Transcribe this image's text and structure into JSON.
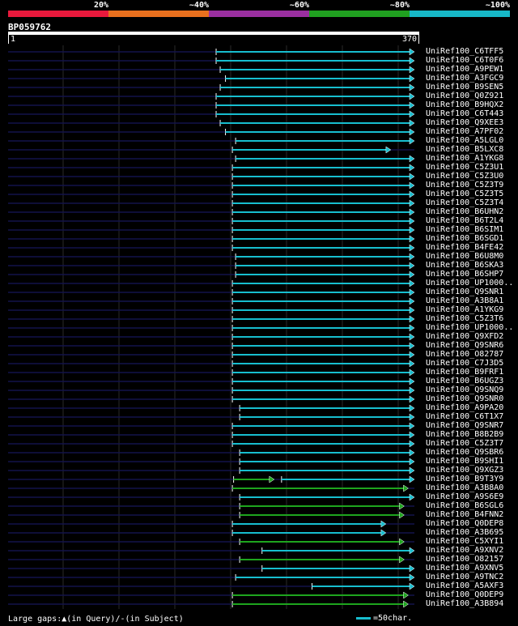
{
  "legend": {
    "labels": [
      "20%",
      "~40%",
      "~60%",
      "~80%",
      "~100%"
    ],
    "colors": [
      "#e8193c",
      "#e8701e",
      "#9a2fa0",
      "#20a020",
      "#17b8c8"
    ]
  },
  "query": {
    "name": "BP059762",
    "start": "1",
    "end": "370"
  },
  "hits": [
    {
      "name": "UniRef100_C6TFF5",
      "segments": [
        {
          "s": 0.512,
          "e": 1.0,
          "c": "cyan",
          "arrow": true
        }
      ]
    },
    {
      "name": "UniRef100_C6T0F6",
      "segments": [
        {
          "s": 0.512,
          "e": 1.0,
          "c": "cyan",
          "arrow": true
        }
      ]
    },
    {
      "name": "UniRef100_A9PEW1",
      "segments": [
        {
          "s": 0.522,
          "e": 1.0,
          "c": "cyan",
          "arrow": true
        }
      ]
    },
    {
      "name": "UniRef100_A3FGC9",
      "segments": [
        {
          "s": 0.535,
          "e": 1.0,
          "c": "cyan",
          "arrow": true
        }
      ]
    },
    {
      "name": "UniRef100_B9SEN5",
      "segments": [
        {
          "s": 0.522,
          "e": 1.0,
          "c": "cyan",
          "arrow": true
        }
      ]
    },
    {
      "name": "UniRef100_Q0Z921",
      "segments": [
        {
          "s": 0.512,
          "e": 1.0,
          "c": "cyan",
          "arrow": true
        }
      ]
    },
    {
      "name": "UniRef100_B9HQX2",
      "segments": [
        {
          "s": 0.512,
          "e": 1.0,
          "c": "cyan",
          "arrow": true
        }
      ]
    },
    {
      "name": "UniRef100_C6T443",
      "segments": [
        {
          "s": 0.512,
          "e": 1.0,
          "c": "cyan",
          "arrow": true
        }
      ]
    },
    {
      "name": "UniRef100_Q9XEE3",
      "segments": [
        {
          "s": 0.522,
          "e": 1.0,
          "c": "cyan",
          "arrow": true
        }
      ]
    },
    {
      "name": "UniRef100_A7PF02",
      "segments": [
        {
          "s": 0.535,
          "e": 1.0,
          "c": "cyan",
          "arrow": true
        }
      ]
    },
    {
      "name": "UniRef100_A5LGL0",
      "segments": [
        {
          "s": 0.56,
          "e": 1.0,
          "c": "cyan",
          "arrow": true
        }
      ]
    },
    {
      "name": "UniRef100_B5LXC8",
      "segments": [
        {
          "s": 0.552,
          "e": 0.942,
          "c": "cyan",
          "arrow": true
        }
      ]
    },
    {
      "name": "UniRef100_A1YKG8",
      "segments": [
        {
          "s": 0.56,
          "e": 1.0,
          "c": "cyan",
          "arrow": true
        }
      ]
    },
    {
      "name": "UniRef100_C5Z3U1",
      "segments": [
        {
          "s": 0.552,
          "e": 1.0,
          "c": "cyan",
          "arrow": true
        }
      ]
    },
    {
      "name": "UniRef100_C5Z3U0",
      "segments": [
        {
          "s": 0.552,
          "e": 1.0,
          "c": "cyan",
          "arrow": true
        }
      ]
    },
    {
      "name": "UniRef100_C5Z3T9",
      "segments": [
        {
          "s": 0.552,
          "e": 1.0,
          "c": "cyan",
          "arrow": true
        }
      ]
    },
    {
      "name": "UniRef100_C5Z3T5",
      "segments": [
        {
          "s": 0.552,
          "e": 1.0,
          "c": "cyan",
          "arrow": true
        }
      ]
    },
    {
      "name": "UniRef100_C5Z3T4",
      "segments": [
        {
          "s": 0.552,
          "e": 1.0,
          "c": "cyan",
          "arrow": true
        }
      ]
    },
    {
      "name": "UniRef100_B6UHN2",
      "segments": [
        {
          "s": 0.552,
          "e": 1.0,
          "c": "cyan",
          "arrow": true
        }
      ]
    },
    {
      "name": "UniRef100_B6T2L4",
      "segments": [
        {
          "s": 0.552,
          "e": 1.0,
          "c": "cyan",
          "arrow": true
        }
      ]
    },
    {
      "name": "UniRef100_B6SIM1",
      "segments": [
        {
          "s": 0.552,
          "e": 1.0,
          "c": "cyan",
          "arrow": true
        }
      ]
    },
    {
      "name": "UniRef100_B6SGD1",
      "segments": [
        {
          "s": 0.552,
          "e": 1.0,
          "c": "cyan",
          "arrow": true
        }
      ]
    },
    {
      "name": "UniRef100_B4FE42",
      "segments": [
        {
          "s": 0.552,
          "e": 1.0,
          "c": "cyan",
          "arrow": true
        }
      ]
    },
    {
      "name": "UniRef100_B6U8M0",
      "segments": [
        {
          "s": 0.56,
          "e": 1.0,
          "c": "cyan",
          "arrow": true
        }
      ]
    },
    {
      "name": "UniRef100_B6SKA3",
      "segments": [
        {
          "s": 0.56,
          "e": 1.0,
          "c": "cyan",
          "arrow": true
        }
      ]
    },
    {
      "name": "UniRef100_B6SHP7",
      "segments": [
        {
          "s": 0.56,
          "e": 1.0,
          "c": "cyan",
          "arrow": true
        }
      ]
    },
    {
      "name": "UniRef100_UP1000..",
      "segments": [
        {
          "s": 0.552,
          "e": 1.0,
          "c": "cyan",
          "arrow": true
        }
      ]
    },
    {
      "name": "UniRef100_Q9SNR1",
      "segments": [
        {
          "s": 0.552,
          "e": 1.0,
          "c": "cyan",
          "arrow": true
        }
      ]
    },
    {
      "name": "UniRef100_A3B8A1",
      "segments": [
        {
          "s": 0.552,
          "e": 1.0,
          "c": "cyan",
          "arrow": true
        }
      ]
    },
    {
      "name": "UniRef100_A1YKG9",
      "segments": [
        {
          "s": 0.552,
          "e": 1.0,
          "c": "cyan",
          "arrow": true
        }
      ]
    },
    {
      "name": "UniRef100_C5Z3T6",
      "segments": [
        {
          "s": 0.552,
          "e": 1.0,
          "c": "cyan",
          "arrow": true
        }
      ]
    },
    {
      "name": "UniRef100_UP1000..",
      "segments": [
        {
          "s": 0.552,
          "e": 1.0,
          "c": "cyan",
          "arrow": true
        }
      ]
    },
    {
      "name": "UniRef100_Q9XFD2",
      "segments": [
        {
          "s": 0.552,
          "e": 1.0,
          "c": "cyan",
          "arrow": true
        }
      ]
    },
    {
      "name": "UniRef100_Q9SNR6",
      "segments": [
        {
          "s": 0.552,
          "e": 1.0,
          "c": "cyan",
          "arrow": true
        }
      ]
    },
    {
      "name": "UniRef100_O82787",
      "segments": [
        {
          "s": 0.552,
          "e": 1.0,
          "c": "cyan",
          "arrow": true
        }
      ]
    },
    {
      "name": "UniRef100_C7J3D5",
      "segments": [
        {
          "s": 0.552,
          "e": 1.0,
          "c": "cyan",
          "arrow": true
        }
      ]
    },
    {
      "name": "UniRef100_B9FRF1",
      "segments": [
        {
          "s": 0.552,
          "e": 1.0,
          "c": "cyan",
          "arrow": true
        }
      ]
    },
    {
      "name": "UniRef100_B6UGZ3",
      "segments": [
        {
          "s": 0.552,
          "e": 1.0,
          "c": "cyan",
          "arrow": true
        }
      ]
    },
    {
      "name": "UniRef100_Q9SNQ9",
      "segments": [
        {
          "s": 0.552,
          "e": 1.0,
          "c": "cyan",
          "arrow": true
        }
      ]
    },
    {
      "name": "UniRef100_Q9SNR0",
      "segments": [
        {
          "s": 0.552,
          "e": 1.0,
          "c": "cyan",
          "arrow": true
        }
      ]
    },
    {
      "name": "UniRef100_A9PA20",
      "segments": [
        {
          "s": 0.57,
          "e": 1.0,
          "c": "cyan",
          "arrow": true
        }
      ]
    },
    {
      "name": "UniRef100_C6T1X7",
      "segments": [
        {
          "s": 0.57,
          "e": 1.0,
          "c": "cyan",
          "arrow": true
        }
      ]
    },
    {
      "name": "UniRef100_Q9SNR7",
      "segments": [
        {
          "s": 0.552,
          "e": 1.0,
          "c": "cyan",
          "arrow": true
        }
      ]
    },
    {
      "name": "UniRef100_B8B2B9",
      "segments": [
        {
          "s": 0.552,
          "e": 1.0,
          "c": "cyan",
          "arrow": true
        }
      ]
    },
    {
      "name": "UniRef100_C5Z3T7",
      "segments": [
        {
          "s": 0.552,
          "e": 1.0,
          "c": "cyan",
          "arrow": true
        }
      ]
    },
    {
      "name": "UniRef100_Q9SBR6",
      "segments": [
        {
          "s": 0.57,
          "e": 1.0,
          "c": "cyan",
          "arrow": true
        }
      ]
    },
    {
      "name": "UniRef100_B9SHI1",
      "segments": [
        {
          "s": 0.57,
          "e": 1.0,
          "c": "cyan",
          "arrow": true
        }
      ]
    },
    {
      "name": "UniRef100_Q9XGZ3",
      "segments": [
        {
          "s": 0.57,
          "e": 1.0,
          "c": "cyan",
          "arrow": true
        }
      ]
    },
    {
      "name": "UniRef100_B9T3Y9",
      "segments": [
        {
          "s": 0.555,
          "e": 0.655,
          "c": "green",
          "arrow": true
        },
        {
          "s": 0.673,
          "e": 1.0,
          "c": "cyan",
          "arrow": true
        }
      ]
    },
    {
      "name": "UniRef100_A3B8A0",
      "segments": [
        {
          "s": 0.552,
          "e": 0.985,
          "c": "green",
          "arrow": true
        }
      ]
    },
    {
      "name": "UniRef100_A9S6E9",
      "segments": [
        {
          "s": 0.57,
          "e": 1.0,
          "c": "cyan",
          "arrow": true
        }
      ]
    },
    {
      "name": "UniRef100_B6SGL6",
      "segments": [
        {
          "s": 0.57,
          "e": 0.975,
          "c": "green",
          "arrow": true
        }
      ]
    },
    {
      "name": "UniRef100_B4FNN2",
      "segments": [
        {
          "s": 0.57,
          "e": 0.975,
          "c": "green",
          "arrow": true
        }
      ]
    },
    {
      "name": "UniRef100_Q0DEP8",
      "segments": [
        {
          "s": 0.552,
          "e": 0.93,
          "c": "cyan",
          "arrow": true
        }
      ]
    },
    {
      "name": "UniRef100_A3B695",
      "segments": [
        {
          "s": 0.552,
          "e": 0.93,
          "c": "cyan",
          "arrow": true
        }
      ]
    },
    {
      "name": "UniRef100_C5XYI1",
      "segments": [
        {
          "s": 0.57,
          "e": 0.975,
          "c": "green",
          "arrow": true
        }
      ]
    },
    {
      "name": "UniRef100_A9XNV2",
      "segments": [
        {
          "s": 0.625,
          "e": 1.0,
          "c": "cyan",
          "arrow": true
        }
      ]
    },
    {
      "name": "UniRef100_O82157",
      "segments": [
        {
          "s": 0.57,
          "e": 0.975,
          "c": "green",
          "arrow": true
        }
      ]
    },
    {
      "name": "UniRef100_A9XNV5",
      "segments": [
        {
          "s": 0.625,
          "e": 1.0,
          "c": "cyan",
          "arrow": true
        }
      ]
    },
    {
      "name": "UniRef100_A9TNC2",
      "segments": [
        {
          "s": 0.56,
          "e": 1.0,
          "c": "cyan",
          "arrow": true
        }
      ]
    },
    {
      "name": "UniRef100_A5AXF3",
      "segments": [
        {
          "s": 0.748,
          "e": 1.0,
          "c": "cyan",
          "arrow": true
        }
      ]
    },
    {
      "name": "UniRef100_Q0DEP9",
      "segments": [
        {
          "s": 0.552,
          "e": 0.985,
          "c": "green",
          "arrow": true
        }
      ]
    },
    {
      "name": "UniRef100_A3B894",
      "segments": [
        {
          "s": 0.552,
          "e": 0.985,
          "c": "green",
          "arrow": true
        }
      ]
    }
  ],
  "footer": {
    "gaps_text": "Large gaps:▲(in Query)/-(in Subject)",
    "scale_text": "=50char."
  }
}
